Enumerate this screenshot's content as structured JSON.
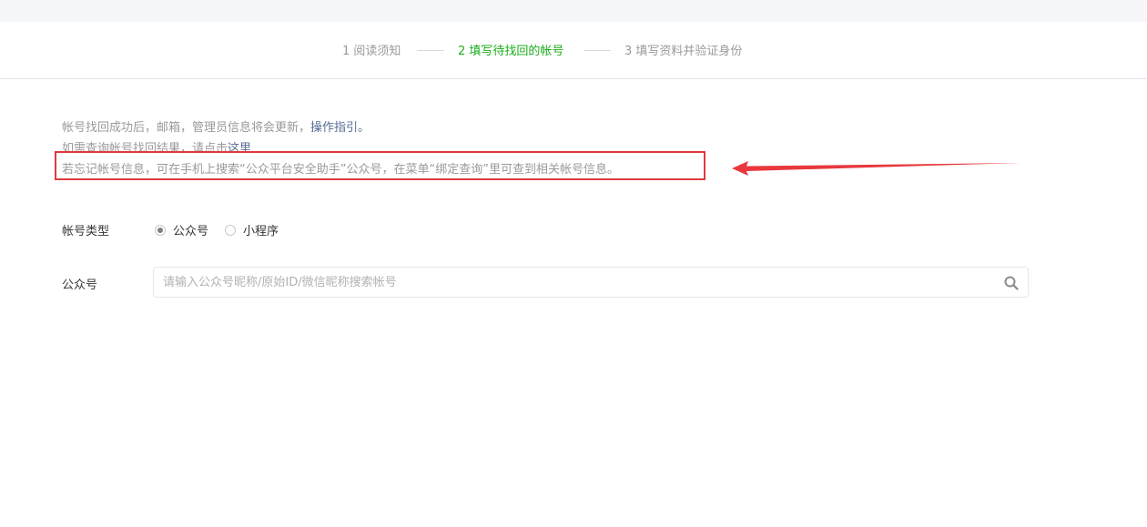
{
  "steps": [
    {
      "label": "1 阅读须知",
      "active": false
    },
    {
      "label": "2 填写待找回的帐号",
      "active": true
    },
    {
      "label": "3 填写资料并验证身份",
      "active": false
    }
  ],
  "info": {
    "line1_text": "帐号找回成功后，邮箱，管理员信息将会更新，",
    "line1_link": "操作指引。",
    "line2_text": "如需查询帐号找回结果，请点击",
    "line2_link": "这里",
    "line3_text": "若忘记帐号信息，可在手机上搜索“公众平台安全助手”公众号，在菜单“绑定查询”里可查到相关帐号信息。"
  },
  "form": {
    "account_type_label": "帐号类型",
    "options": [
      {
        "label": "公众号",
        "checked": true
      },
      {
        "label": "小程序",
        "checked": false
      }
    ],
    "account_label": "公众号",
    "search_placeholder": "请输入公众号昵称/原始ID/微信昵称搜索帐号"
  },
  "annotation": {
    "box_color": "#e03a3e",
    "arrow_color": "#e8383d"
  },
  "colors": {
    "active_step": "#1aad19",
    "link": "#576b95"
  }
}
